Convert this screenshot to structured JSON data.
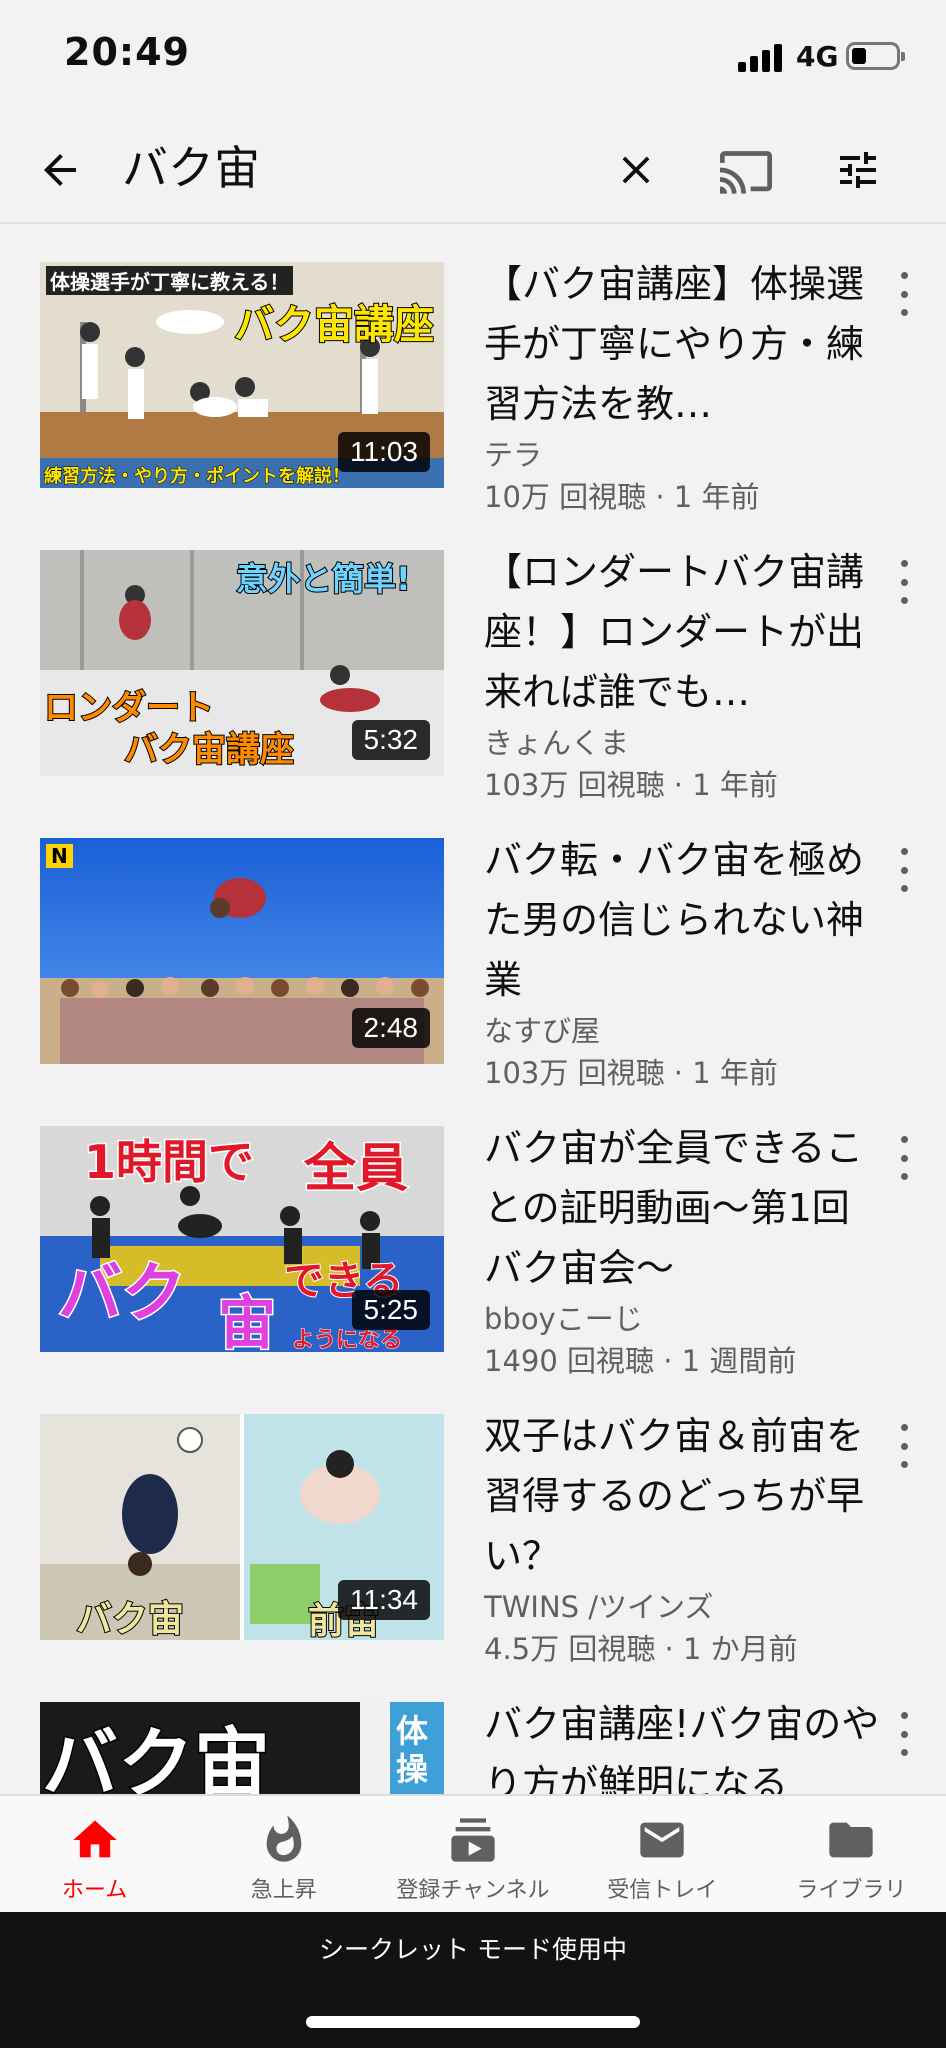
{
  "status": {
    "time": "20:49",
    "network": "4G"
  },
  "search": {
    "query": "バク宙"
  },
  "videos": [
    {
      "title": "【バク宙講座】体操選手が丁寧にやり方・練習方法を教…",
      "channel": "テラ",
      "stats": "10万 回視聴 · 1 年前",
      "duration": "11:03",
      "thumb_text": [
        "体操選手が丁寧に教える！",
        "バク宙講座",
        "練習方法・やり方・ポイントを解説！"
      ]
    },
    {
      "title": "【ロンダートバク宙講座！】ロンダートが出来れば誰でも…",
      "channel": "きょんくま",
      "stats": "103万 回視聴 · 1 年前",
      "duration": "5:32",
      "thumb_text": [
        "意外と簡単!",
        "ロンダート",
        "バク宙講座"
      ]
    },
    {
      "title": "バク転・バク宙を極めた男の信じられない神業",
      "channel": "なすび屋",
      "stats": "103万 回視聴 · 1 年前",
      "duration": "2:48",
      "thumb_text": [
        "N"
      ]
    },
    {
      "title": "バク宙が全員できることの証明動画〜第1回バク宙会〜",
      "channel": "bboyこーじ",
      "stats": "1490 回視聴 · 1 週間前",
      "duration": "5:25",
      "thumb_text": [
        "1時間で",
        "全員",
        "バク",
        "宙",
        "できる",
        "ようになる"
      ]
    },
    {
      "title": "双子はバク宙＆前宙を習得するのどっちが早い？",
      "channel": "TWINS /ツインズ",
      "stats": "4.5万 回視聴 · 1 か月前",
      "duration": "11:34",
      "thumb_text": [
        "バク宙",
        "前宙"
      ]
    },
    {
      "title": "バク宙講座!バク宙のやり方が鮮明になる",
      "channel": "",
      "stats": "",
      "duration": "",
      "thumb_text": [
        "バク宙",
        "体",
        "操"
      ]
    }
  ],
  "nav": [
    {
      "label": "ホーム",
      "icon": "home-icon",
      "active": true
    },
    {
      "label": "急上昇",
      "icon": "trending-icon",
      "active": false
    },
    {
      "label": "登録チャンネル",
      "icon": "subscriptions-icon",
      "active": false
    },
    {
      "label": "受信トレイ",
      "icon": "inbox-icon",
      "active": false
    },
    {
      "label": "ライブラリ",
      "icon": "library-icon",
      "active": false
    }
  ],
  "incognito": {
    "text": "シークレット モード使用中"
  },
  "colors": {
    "accent": "#ff0000",
    "background": "#f2f2f2",
    "secondary_text": "#606060"
  }
}
